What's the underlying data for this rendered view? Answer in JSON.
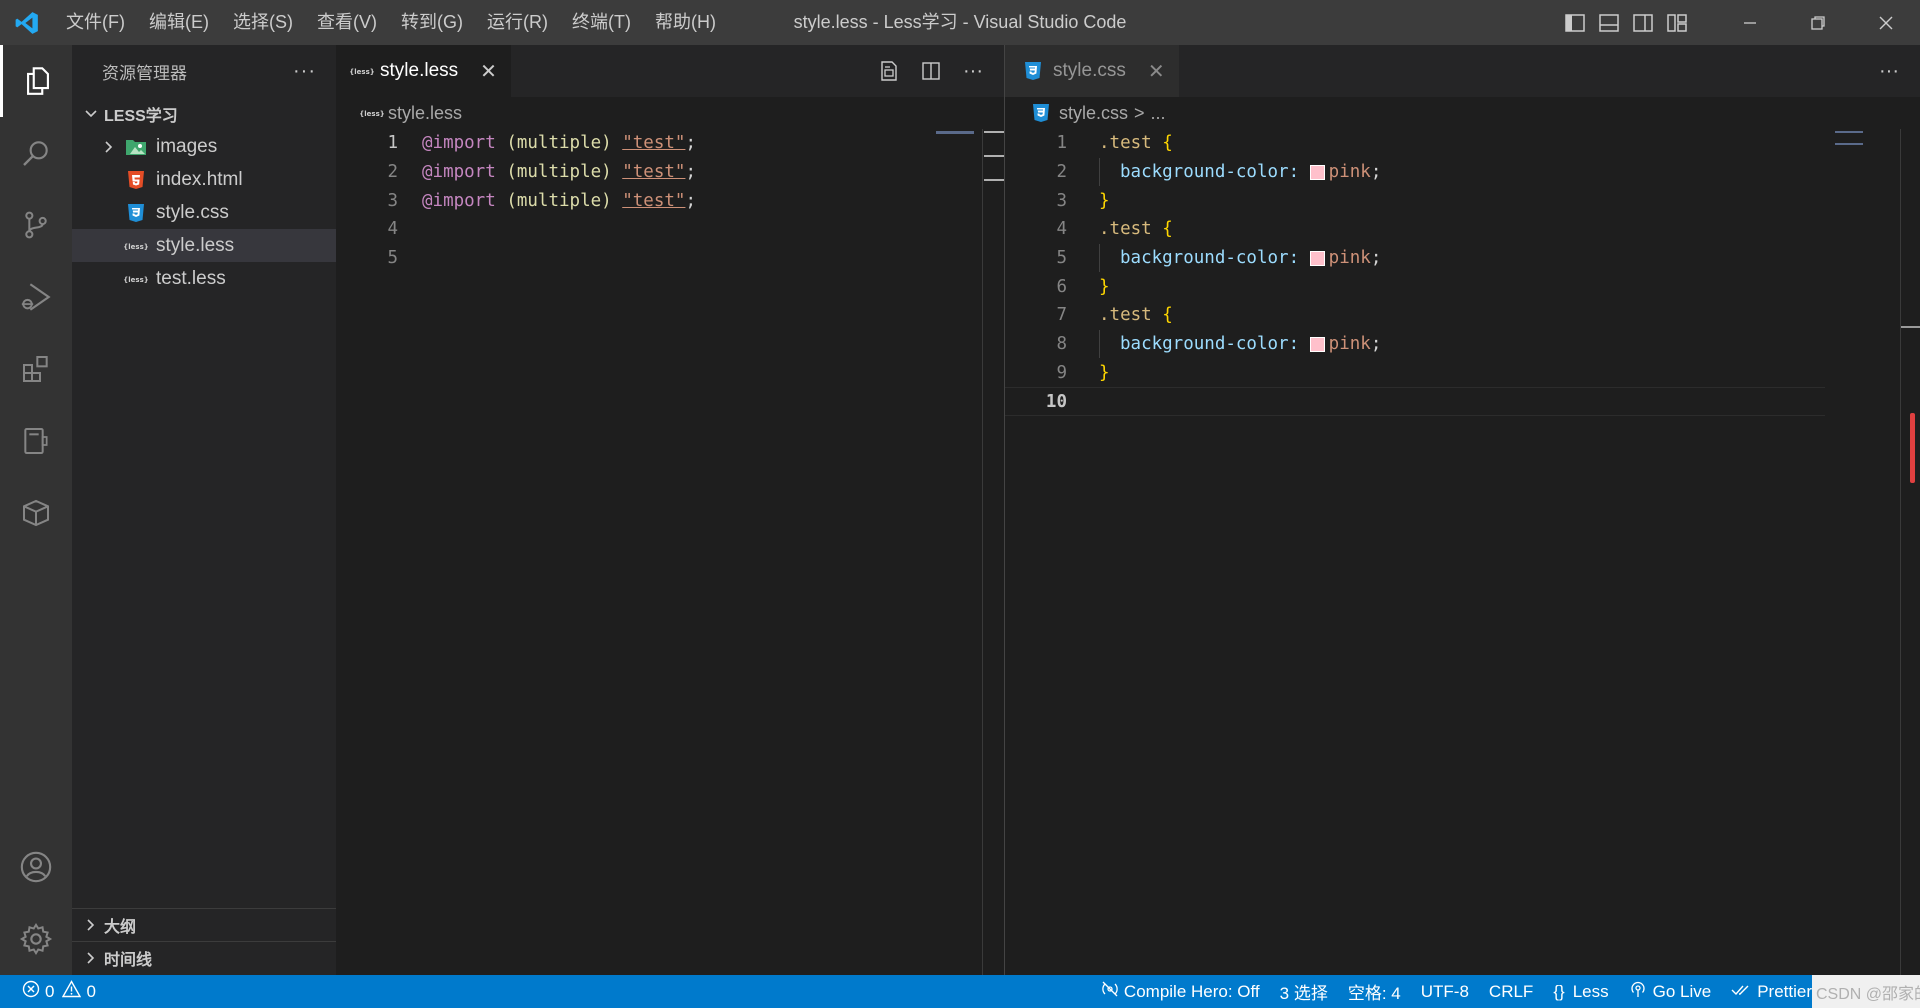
{
  "titlebar": {
    "window_title": "style.less - Less学习 - Visual Studio Code",
    "menu": [
      "文件(F)",
      "编辑(E)",
      "选择(S)",
      "查看(V)",
      "转到(G)",
      "运行(R)",
      "终端(T)",
      "帮助(H)"
    ]
  },
  "activitybar": {
    "icons": [
      "explorer-icon",
      "search-icon",
      "source-control-icon",
      "run-debug-icon",
      "extensions-icon",
      "remote-explorer-icon",
      "package-icon",
      "account-icon",
      "settings-gear-icon"
    ]
  },
  "sidebar": {
    "title": "资源管理器",
    "more": "···",
    "root_folder": "LESS学习",
    "items": [
      {
        "label": "images",
        "icon": "folder-images-icon"
      },
      {
        "label": "index.html",
        "icon": "html-file-icon"
      },
      {
        "label": "style.css",
        "icon": "css-file-icon"
      },
      {
        "label": "style.less",
        "icon": "less-file-icon"
      },
      {
        "label": "test.less",
        "icon": "less-file-icon"
      }
    ],
    "outline_label": "大纲",
    "timeline_label": "时间线"
  },
  "left_editor": {
    "tab_label": "style.less",
    "tab_close": "✕",
    "breadcrumb": "style.less",
    "more": "···",
    "less_badge": "{less}",
    "lines": [
      {
        "num": "1",
        "at": "@import",
        "paren": "(multiple)",
        "str": "\"test\"",
        "punct": ";"
      },
      {
        "num": "2",
        "at": "@import",
        "paren": "(multiple)",
        "str": "\"test\"",
        "punct": ";"
      },
      {
        "num": "3",
        "at": "@import",
        "paren": "(multiple)",
        "str": "\"test\"",
        "punct": ";"
      },
      {
        "num": "4"
      },
      {
        "num": "5"
      }
    ]
  },
  "right_editor": {
    "tab_label": "style.css",
    "tab_close": "✕",
    "breadcrumb_file": "style.css",
    "breadcrumb_sep": ">",
    "breadcrumb_more": "...",
    "more": "···",
    "css_badge": "3",
    "line_numbers": [
      "1",
      "2",
      "3",
      "4",
      "5",
      "6",
      "7",
      "8",
      "9",
      "10"
    ],
    "selector": ".test",
    "open_brace": "{",
    "close_brace": "}",
    "property": "background-color:",
    "value": "pink",
    "semicolon": ";",
    "swatch_color": "#ffc0cb"
  },
  "statusbar": {
    "errors": "0",
    "warnings": "0",
    "compile_hero": "Compile Hero: Off",
    "selection": "3 选择",
    "spaces": "空格: 4",
    "encoding": "UTF-8",
    "eol": "CRLF",
    "language": "Less",
    "go_live": "Go Live",
    "prettier": "Prettier",
    "watermark": "CSDN @邵家的肥猫"
  },
  "colors": {
    "accent": "#007acc",
    "titlebar": "#3c3c3c",
    "activitybar": "#333333",
    "sidebar": "#252526",
    "editor": "#1e1e1e"
  }
}
